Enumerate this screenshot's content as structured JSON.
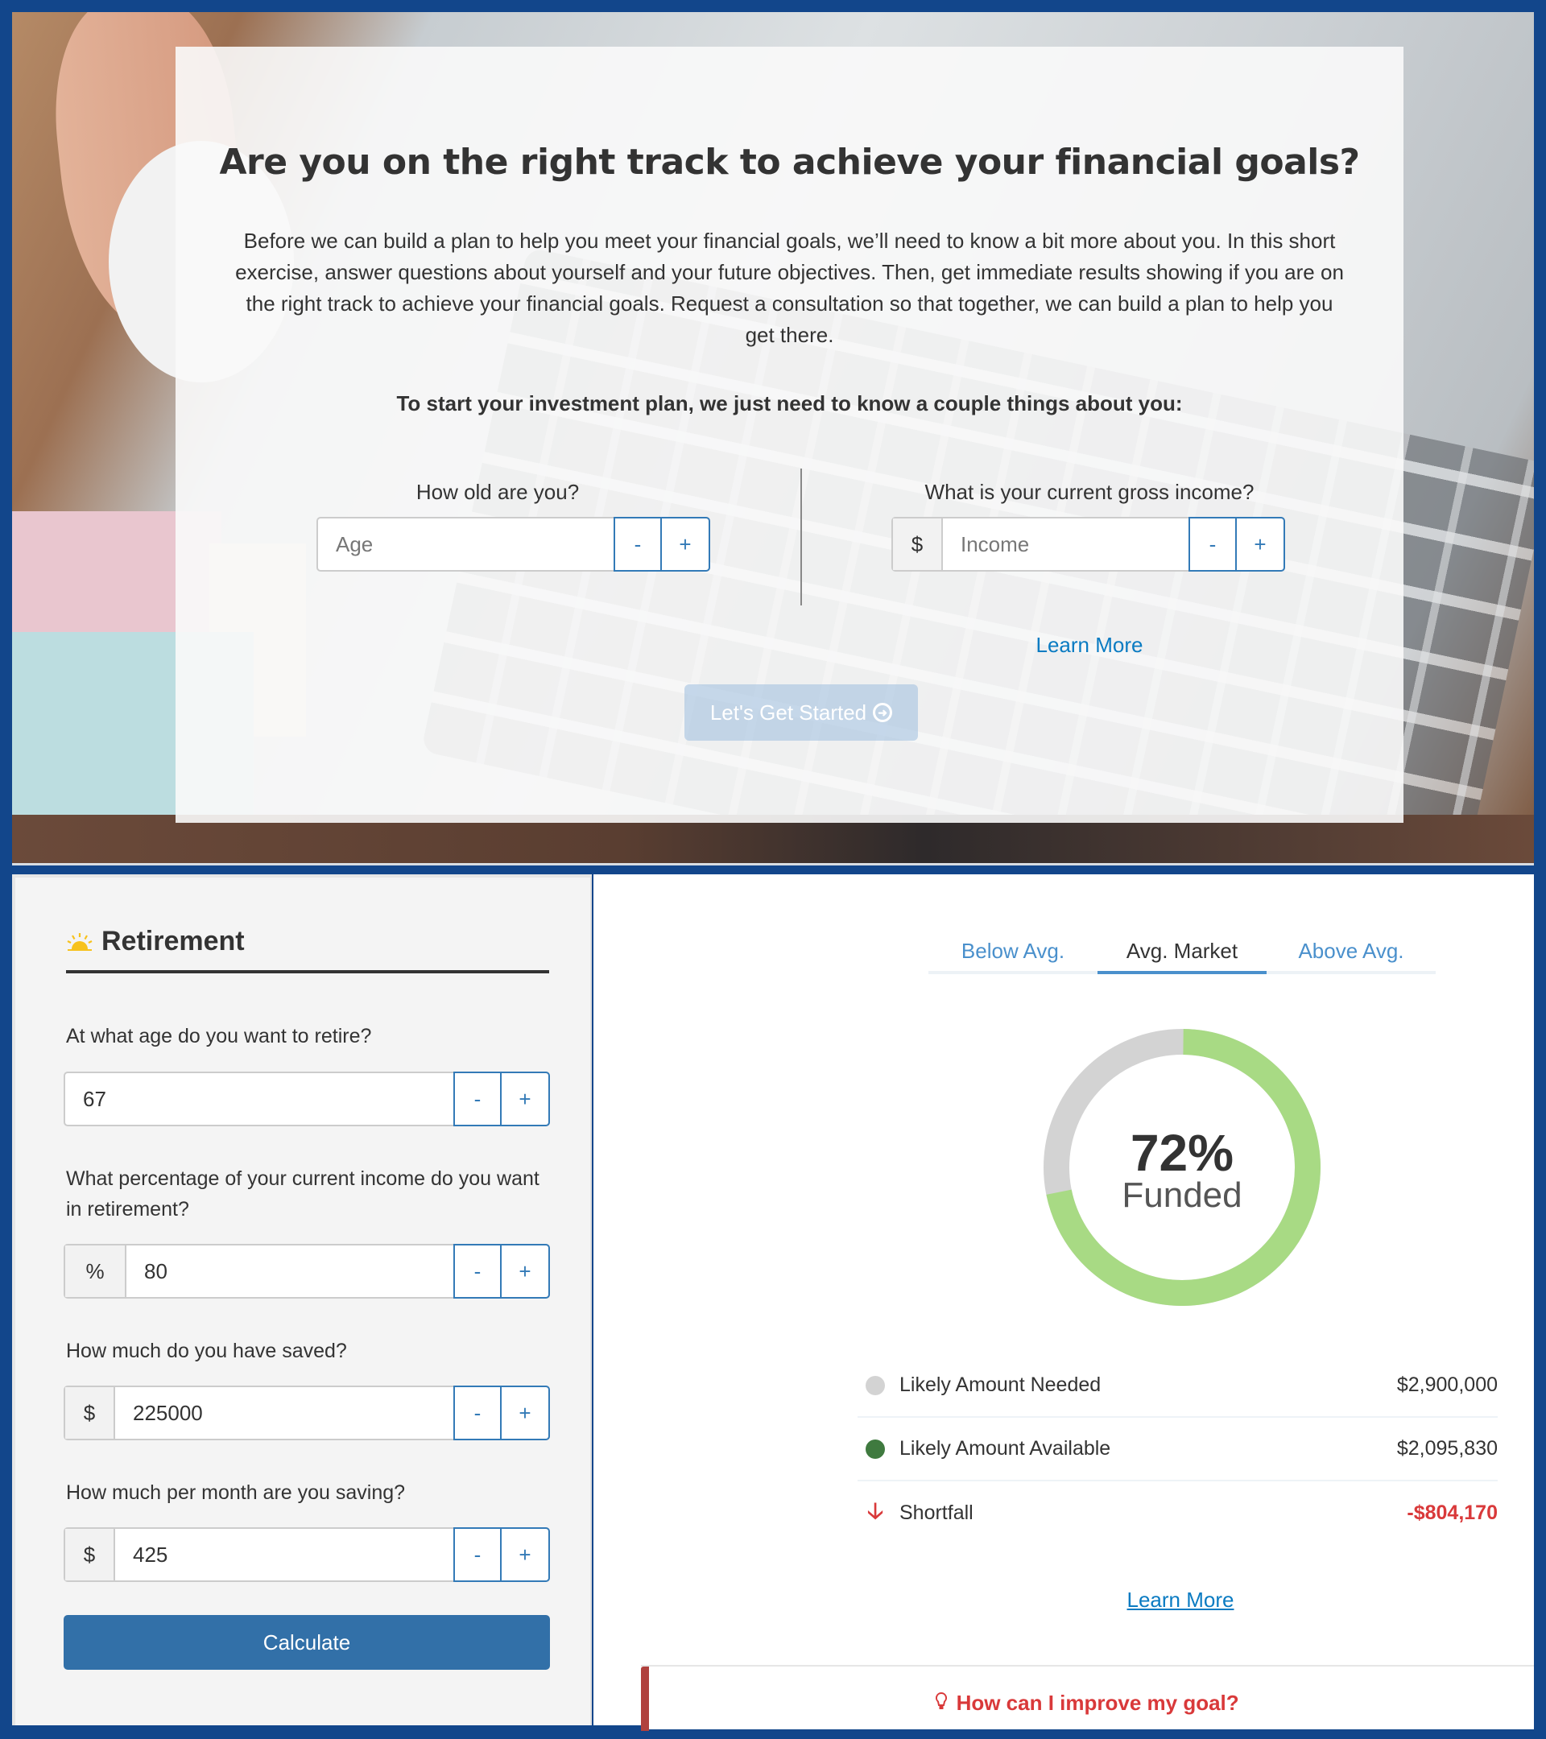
{
  "hero": {
    "title": "Are you on the right track to achieve your financial goals?",
    "intro": "Before we can build a plan to help you meet your financial goals, we’ll need to know a bit more about you. In this short exercise, answer questions about yourself and your future objectives. Then, get immediate results showing if you are on the right track to achieve your financial goals. Request a consultation so that together, we can build a plan to help you get there.",
    "lead": "To start your investment plan, we just need to know a couple things about you:",
    "age": {
      "label": "How old are you?",
      "placeholder": "Age",
      "value": "",
      "minus": "-",
      "plus": "+"
    },
    "income": {
      "label": "What is your current gross income?",
      "prefix": "$",
      "placeholder": "Income",
      "value": "",
      "minus": "-",
      "plus": "+"
    },
    "learn_more": "Learn More",
    "start_button": "Let's Get Started",
    "start_icon": "arrow-circle-right-icon"
  },
  "retirement": {
    "heading": "Retirement",
    "heading_icon": "sunrise-icon",
    "fields": [
      {
        "label": "At what age do you want to retire?",
        "prefix": "",
        "value": "67",
        "minus": "-",
        "plus": "+"
      },
      {
        "label": "What percentage of your current income do you want in retirement?",
        "prefix": "%",
        "value": "80",
        "minus": "-",
        "plus": "+"
      },
      {
        "label": "How much do you have saved?",
        "prefix": "$",
        "value": "225000",
        "minus": "-",
        "plus": "+"
      },
      {
        "label": "How much per month are you saving?",
        "prefix": "$",
        "value": "425",
        "minus": "-",
        "plus": "+"
      }
    ],
    "calculate": "Calculate"
  },
  "results": {
    "tabs": [
      {
        "label": "Below Avg.",
        "active": false
      },
      {
        "label": "Avg. Market",
        "active": true
      },
      {
        "label": "Above Avg.",
        "active": false
      }
    ],
    "funded_percent": 72,
    "funded_text": "72%",
    "funded_label": "Funded",
    "colors": {
      "funded": "#a8da84",
      "unfunded": "#d3d3d3",
      "available_dot": "#3f7a3f",
      "shortfall": "#d9393a"
    },
    "legend": [
      {
        "name": "Likely Amount Needed",
        "value": "$2,900,000",
        "marker": "grey-dot"
      },
      {
        "name": "Likely Amount Available",
        "value": "$2,095,830",
        "marker": "green-dot"
      },
      {
        "name": "Shortfall",
        "value": "-$804,170",
        "marker": "down-arrow-icon"
      }
    ],
    "learn_more": "Learn More",
    "improve": "How can I improve my goal?",
    "improve_icon": "lightbulb-icon"
  }
}
